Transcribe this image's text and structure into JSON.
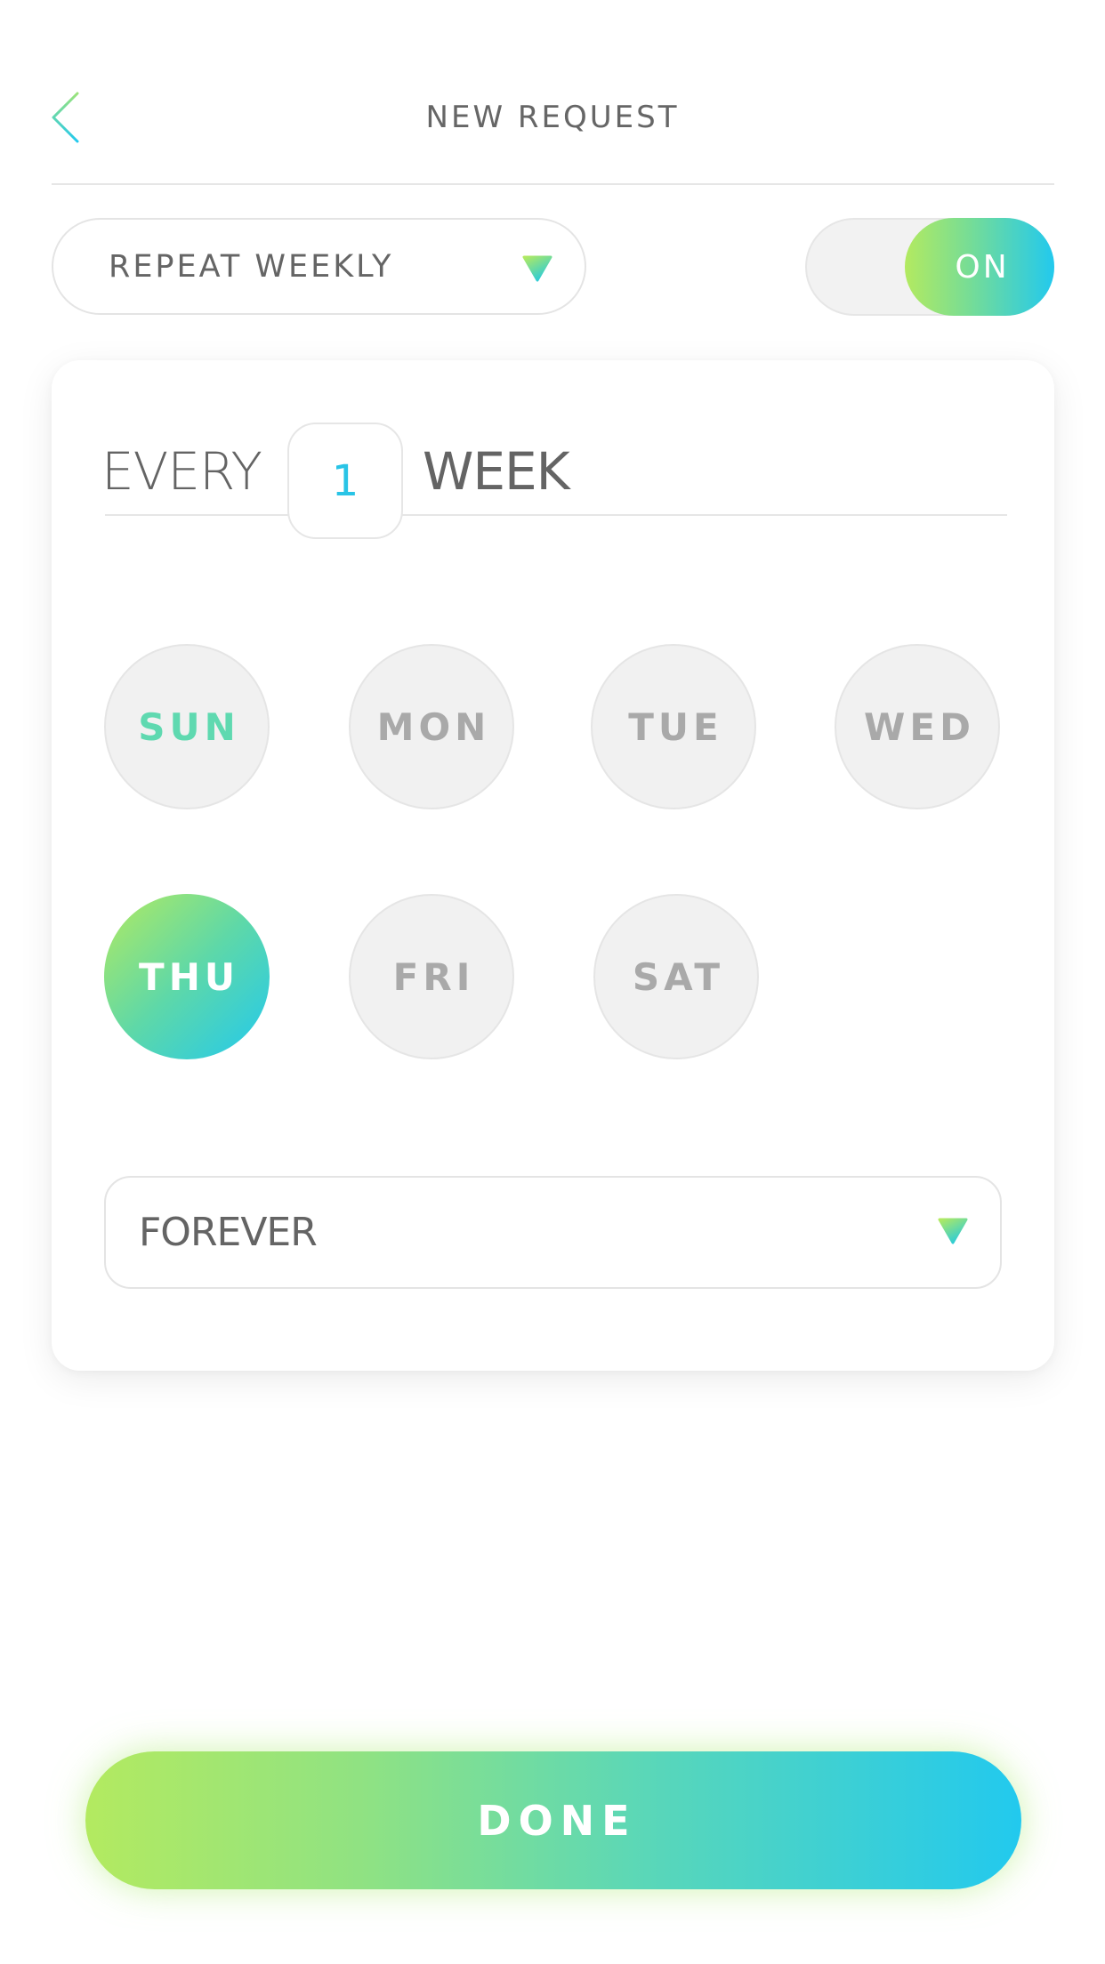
{
  "header": {
    "title": "NEW REQUEST",
    "back_icon": "chevron-left-icon"
  },
  "repeat": {
    "frequency_value": "REPEAT WEEKLY",
    "dropdown_icon": "triangle-down-icon",
    "toggle": {
      "state": "on",
      "label": "ON"
    }
  },
  "schedule": {
    "every_label": "EVERY",
    "interval_value": "1",
    "unit_label": "WEEK",
    "days": [
      {
        "label": "SUN",
        "selected": false,
        "highlighted": true
      },
      {
        "label": "MON",
        "selected": false,
        "highlighted": false
      },
      {
        "label": "TUE",
        "selected": false,
        "highlighted": false
      },
      {
        "label": "WED",
        "selected": false,
        "highlighted": false
      },
      {
        "label": "THU",
        "selected": true,
        "highlighted": false
      },
      {
        "label": "FRI",
        "selected": false,
        "highlighted": false
      },
      {
        "label": "SAT",
        "selected": false,
        "highlighted": false
      }
    ],
    "ends_value": "FOREVER"
  },
  "footer": {
    "done_label": "DONE"
  },
  "colors": {
    "gradient_start": "#b3ea60",
    "gradient_end": "#22c9ee",
    "text": "#666666",
    "accent_number": "#29c4e6",
    "today_text": "#5fd9b0",
    "inactive_day_text": "#a9a9a9"
  }
}
